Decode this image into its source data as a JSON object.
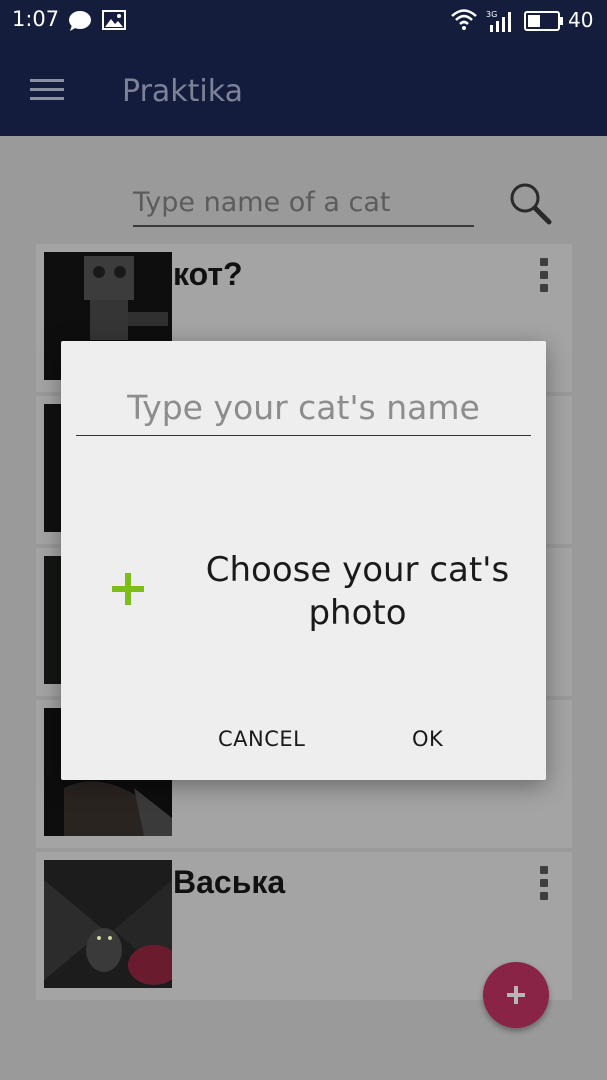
{
  "status_bar": {
    "time": "1:07",
    "network_label": "3G",
    "battery": "40"
  },
  "app_bar": {
    "title": "Praktika"
  },
  "search": {
    "placeholder": "Type name of a cat"
  },
  "cats": [
    {
      "name": "кот?"
    },
    {
      "name": ""
    },
    {
      "name": ""
    },
    {
      "name": ""
    },
    {
      "name": "Васька"
    }
  ],
  "dialog": {
    "name_placeholder": "Type your cat's name",
    "photo_line1": "Choose your cat's",
    "photo_line2": "photo",
    "cancel_label": "CANCEL",
    "ok_label": "OK"
  },
  "colors": {
    "app_bar": "#1a2466",
    "accent_fab": "#d63a6a",
    "add_photo_plus": "#8bc34a",
    "dialog_bg": "#eeeeee"
  }
}
